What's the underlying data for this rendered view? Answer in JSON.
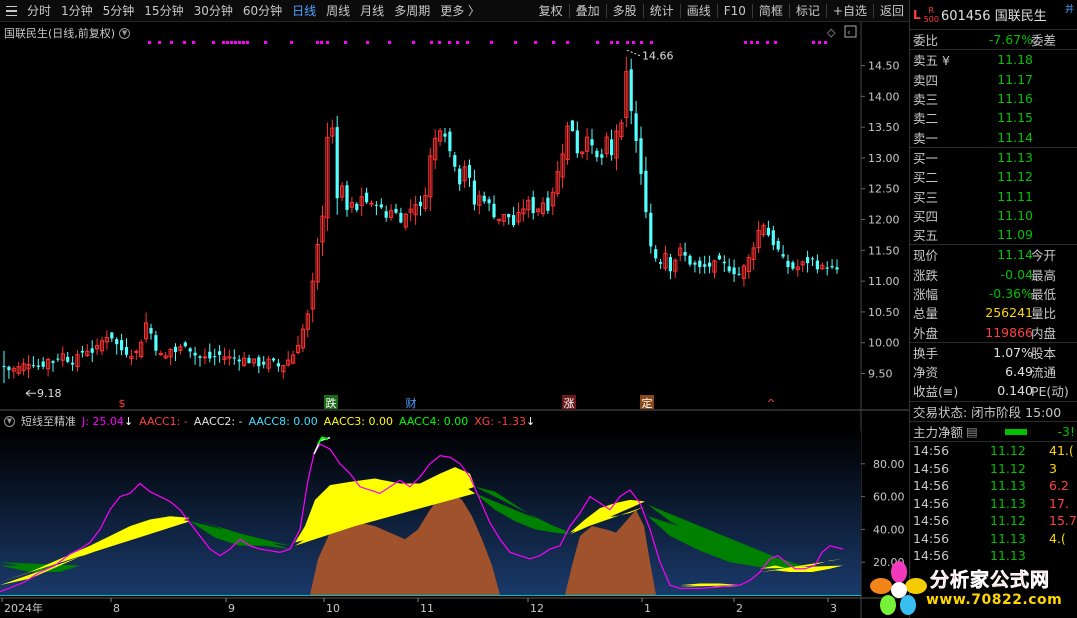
{
  "toolbar": {
    "left": [
      "分时",
      "1分钟",
      "5分钟",
      "15分钟",
      "30分钟",
      "60分钟",
      "日线",
      "周线",
      "月线",
      "多周期",
      "更多 〉"
    ],
    "active": "日线",
    "right": [
      "复权",
      "叠加",
      "多股",
      "统计",
      "画线",
      "F10",
      "简框",
      "标记",
      "+自选",
      "返回"
    ]
  },
  "stock": {
    "title": "国联民生(日线,前复权)",
    "code": "601456",
    "name": "国联民生",
    "market_mark": "L",
    "r500": "R\n500",
    "corner": "并"
  },
  "chart_data": {
    "type": "candlestick",
    "y_ticks": [
      "14.50",
      "14.00",
      "13.50",
      "13.00",
      "12.50",
      "12.00",
      "11.50",
      "11.00",
      "10.50",
      "10.00",
      "9.50"
    ],
    "ylim": [
      9.2,
      14.85
    ],
    "low_label": "9.18",
    "high_label": "14.66",
    "x_ticks": [
      "2024年",
      "8",
      "9",
      "10",
      "11",
      "12",
      "1",
      "2",
      "3"
    ],
    "events": [
      "$",
      "跌",
      "财",
      "涨",
      "定",
      "^"
    ],
    "indicator": {
      "name": "短线至精准",
      "j": "J: 25.04",
      "aacc1": "AACC1: -",
      "aacc2": "AACC2: -",
      "aacc8": "AACC8: 0.00",
      "aacc3": "AACC3: 0.00",
      "aacc4": "AACC4: 0.00",
      "xg": "XG: -1.33",
      "y_ticks": [
        "80.00",
        "60.00",
        "40.00",
        "20.00"
      ],
      "ylim": [
        0,
        100
      ]
    }
  },
  "panel": {
    "weibi": {
      "label": "委比",
      "value": "-7.67%",
      "label2": "委差"
    },
    "asks": [
      {
        "label": "卖五 ¥",
        "price": "11.18"
      },
      {
        "label": "卖四",
        "price": "11.17"
      },
      {
        "label": "卖三",
        "price": "11.16"
      },
      {
        "label": "卖二",
        "price": "11.15"
      },
      {
        "label": "卖一",
        "price": "11.14"
      }
    ],
    "bids": [
      {
        "label": "买一",
        "price": "11.13"
      },
      {
        "label": "买二",
        "price": "11.12"
      },
      {
        "label": "买三",
        "price": "11.11"
      },
      {
        "label": "买四",
        "price": "11.10"
      },
      {
        "label": "买五",
        "price": "11.09"
      }
    ],
    "quote": [
      {
        "label": "现价",
        "value": "11.14",
        "label2": "今开",
        "color": "green"
      },
      {
        "label": "涨跌",
        "value": "-0.04",
        "label2": "最高",
        "color": "green"
      },
      {
        "label": "涨幅",
        "value": "-0.36%",
        "label2": "最低",
        "color": "green"
      },
      {
        "label": "总量",
        "value": "256241",
        "label2": "量比",
        "color": "yellow"
      },
      {
        "label": "外盘",
        "value": "119866",
        "label2": "内盘",
        "color": "red"
      }
    ],
    "stats": [
      {
        "label": "换手",
        "value": "1.07%",
        "label2": "股本"
      },
      {
        "label": "净资",
        "value": "6.49",
        "label2": "流通"
      },
      {
        "label": "收益(≡)",
        "value": "0.140",
        "label2": "PE(动)"
      }
    ],
    "status": "交易状态: 闭市阶段 15:00",
    "main_force": {
      "label": "主力净额",
      "value": "-3!"
    },
    "ticks": [
      {
        "time": "14:56",
        "price": "11.12",
        "vol": "41.(",
        "pc": "green",
        "vc": "yellow"
      },
      {
        "time": "14:56",
        "price": "11.12",
        "vol": "3",
        "pc": "green",
        "vc": "yellow"
      },
      {
        "time": "14:56",
        "price": "11.13",
        "vol": "6.2",
        "pc": "green",
        "vc": "red"
      },
      {
        "time": "14:56",
        "price": "11.13",
        "vol": "17.",
        "pc": "green",
        "vc": "red"
      },
      {
        "time": "14:56",
        "price": "11.12",
        "vol": "15.7",
        "pc": "green",
        "vc": "red"
      },
      {
        "time": "14:56",
        "price": "11.13",
        "vol": "4.(",
        "pc": "green",
        "vc": "yellow"
      },
      {
        "time": "14:56",
        "price": "11.13",
        "vol": "",
        "pc": "green",
        "vc": "yellow"
      }
    ]
  },
  "watermark": {
    "line1": "分析家公式网",
    "line2": "www.70822.com"
  },
  "colors": {
    "up": "#ff3333",
    "down": "#54ffff",
    "magenta": "#ff00ff",
    "yellow": "#ffff00",
    "green_band": "#008000",
    "brown": "#a0522d"
  }
}
